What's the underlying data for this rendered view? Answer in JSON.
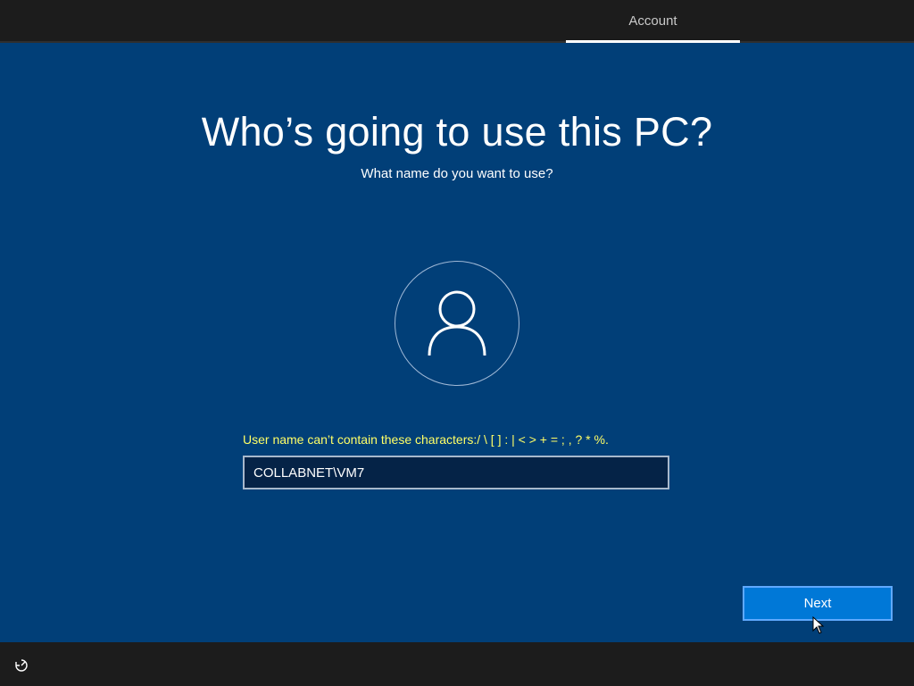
{
  "header": {
    "active_tab": "Account"
  },
  "main": {
    "title": "Who’s going to use this PC?",
    "subtitle": "What name do you want to use?",
    "avatar_icon": "user-icon",
    "error_message": "User name can’t contain these characters:/ \\ [ ] : | < > + = ; , ? * %.",
    "username_value": "COLLABNET\\VM7"
  },
  "footer": {
    "next_label": "Next",
    "accessibility_icon": "ease-of-access-icon"
  },
  "colors": {
    "background": "#013f78",
    "bars": "#1c1c1c",
    "error_text": "#ffff66",
    "next_button": "#0078d7"
  }
}
